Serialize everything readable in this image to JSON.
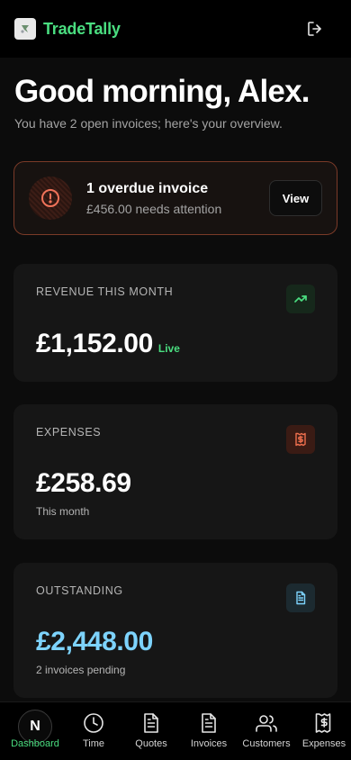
{
  "app": {
    "brand": "TradeTally"
  },
  "header": {
    "greeting": "Good morning, Alex.",
    "subtitle": "You have 2 open invoices; here's your overview."
  },
  "alert": {
    "title": "1 overdue invoice",
    "subtitle": "£456.00 needs attention",
    "button": "View"
  },
  "cards": {
    "revenue": {
      "label": "REVENUE THIS MONTH",
      "value": "£1,152.00",
      "badge": "Live",
      "icon": "trending-up-icon",
      "accent": "#4ade80"
    },
    "expenses": {
      "label": "EXPENSES",
      "value": "£258.69",
      "note": "This month",
      "icon": "receipt-icon",
      "accent": "#ef6f4e"
    },
    "outstanding": {
      "label": "OUTSTANDING",
      "value": "£2,448.00",
      "note": "2 invoices pending",
      "icon": "document-icon",
      "accent": "#7dd3fc"
    }
  },
  "nav": {
    "items": [
      {
        "label": "Dashboard",
        "icon": "dashboard-icon",
        "active": true
      },
      {
        "label": "Time",
        "icon": "clock-icon"
      },
      {
        "label": "Quotes",
        "icon": "document-icon"
      },
      {
        "label": "Invoices",
        "icon": "document-icon"
      },
      {
        "label": "Customers",
        "icon": "users-icon"
      },
      {
        "label": "Expenses",
        "icon": "receipt-icon"
      }
    ],
    "dashboard_glyph": "N"
  }
}
